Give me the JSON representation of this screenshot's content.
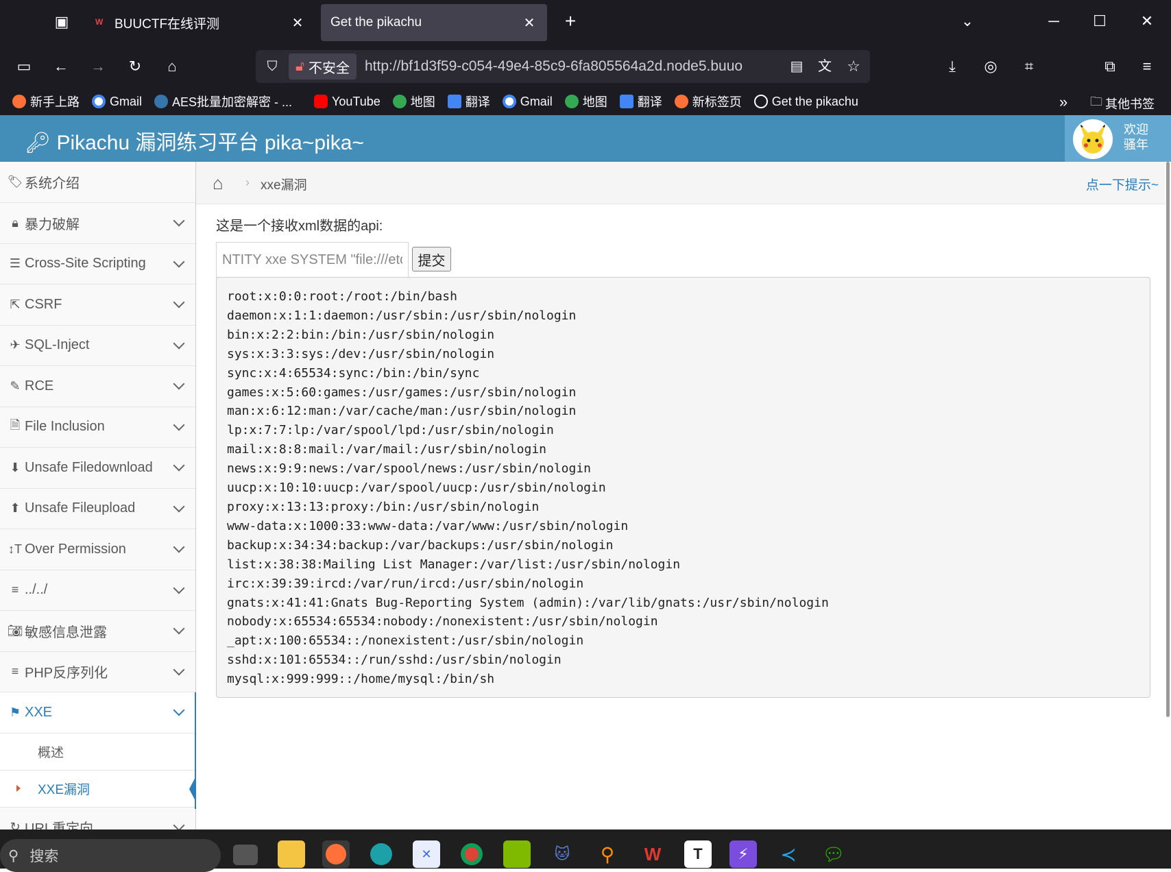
{
  "browser": {
    "tabs": [
      {
        "title": "BUUCTF在线评测",
        "active": false
      },
      {
        "title": "Get the pikachu",
        "active": true
      }
    ],
    "url_security": "不安全",
    "url": "http://bf1d3f59-c054-49e4-85c9-6fa805564a2d.node5.buuo",
    "bookmarks": [
      "新手上路",
      "Gmail",
      "AES批量加密解密 - ...",
      "YouTube",
      "地图",
      "翻译",
      "Gmail",
      "地图",
      "翻译",
      "新标签页",
      "Get the pikachu"
    ],
    "other_bookmarks": "其他书签"
  },
  "header": {
    "brand": "Pikachu 漏洞练习平台 pika~pika~",
    "welcome_line1": "欢迎",
    "welcome_line2": "骚年",
    "color": "#438eb9"
  },
  "sidebar": {
    "items": [
      {
        "label": "系统介绍",
        "icon": "tags-icon"
      },
      {
        "label": "暴力破解",
        "icon": "lock-icon"
      },
      {
        "label": "Cross-Site Scripting",
        "icon": "list-icon"
      },
      {
        "label": "CSRF",
        "icon": "share-icon"
      },
      {
        "label": "SQL-Inject",
        "icon": "fighter-jet-icon"
      },
      {
        "label": "RCE",
        "icon": "pencil-icon"
      },
      {
        "label": "File Inclusion",
        "icon": "file-icon"
      },
      {
        "label": "Unsafe Filedownload",
        "icon": "download-icon"
      },
      {
        "label": "Unsafe Fileupload",
        "icon": "upload-icon"
      },
      {
        "label": "Over Permission",
        "icon": "text-height-icon"
      },
      {
        "label": "../../",
        "icon": "align-left-icon"
      },
      {
        "label": "敏感信息泄露",
        "icon": "camera-icon"
      },
      {
        "label": "PHP反序列化",
        "icon": "align-left-icon"
      },
      {
        "label": "XXE",
        "icon": "flag-icon"
      }
    ],
    "xxe_sub": [
      {
        "label": "概述"
      },
      {
        "label": "XXE漏洞"
      }
    ],
    "next_item": "URL重定向"
  },
  "breadcrumb": {
    "current": "xxe漏洞",
    "hint": "点一下提示~"
  },
  "main": {
    "description": "这是一个接收xml数据的api:",
    "input_value": "NTITY xxe SYSTEM \"file:///etc",
    "submit_label": "提交",
    "output_lines": [
      "root:x:0:0:root:/root:/bin/bash",
      "daemon:x:1:1:daemon:/usr/sbin:/usr/sbin/nologin",
      "bin:x:2:2:bin:/bin:/usr/sbin/nologin",
      "sys:x:3:3:sys:/dev:/usr/sbin/nologin",
      "sync:x:4:65534:sync:/bin:/bin/sync",
      "games:x:5:60:games:/usr/games:/usr/sbin/nologin",
      "man:x:6:12:man:/var/cache/man:/usr/sbin/nologin",
      "lp:x:7:7:lp:/var/spool/lpd:/usr/sbin/nologin",
      "mail:x:8:8:mail:/var/mail:/usr/sbin/nologin",
      "news:x:9:9:news:/var/spool/news:/usr/sbin/nologin",
      "uucp:x:10:10:uucp:/var/spool/uucp:/usr/sbin/nologin",
      "proxy:x:13:13:proxy:/bin:/usr/sbin/nologin",
      "www-data:x:1000:33:www-data:/var/www:/usr/sbin/nologin",
      "backup:x:34:34:backup:/var/backups:/usr/sbin/nologin",
      "list:x:38:38:Mailing List Manager:/var/list:/usr/sbin/nologin",
      "irc:x:39:39:ircd:/var/run/ircd:/usr/sbin/nologin",
      "gnats:x:41:41:Gnats Bug-Reporting System (admin):/var/lib/gnats:/usr/sbin/nologin",
      "nobody:x:65534:65534:nobody:/nonexistent:/usr/sbin/nologin",
      "_apt:x:100:65534::/nonexistent:/usr/sbin/nologin",
      "sshd:x:101:65534::/run/sshd:/usr/sbin/nologin",
      "mysql:x:999:999::/home/mysql:/bin/sh"
    ]
  },
  "taskbar": {
    "search_placeholder": "搜索"
  }
}
